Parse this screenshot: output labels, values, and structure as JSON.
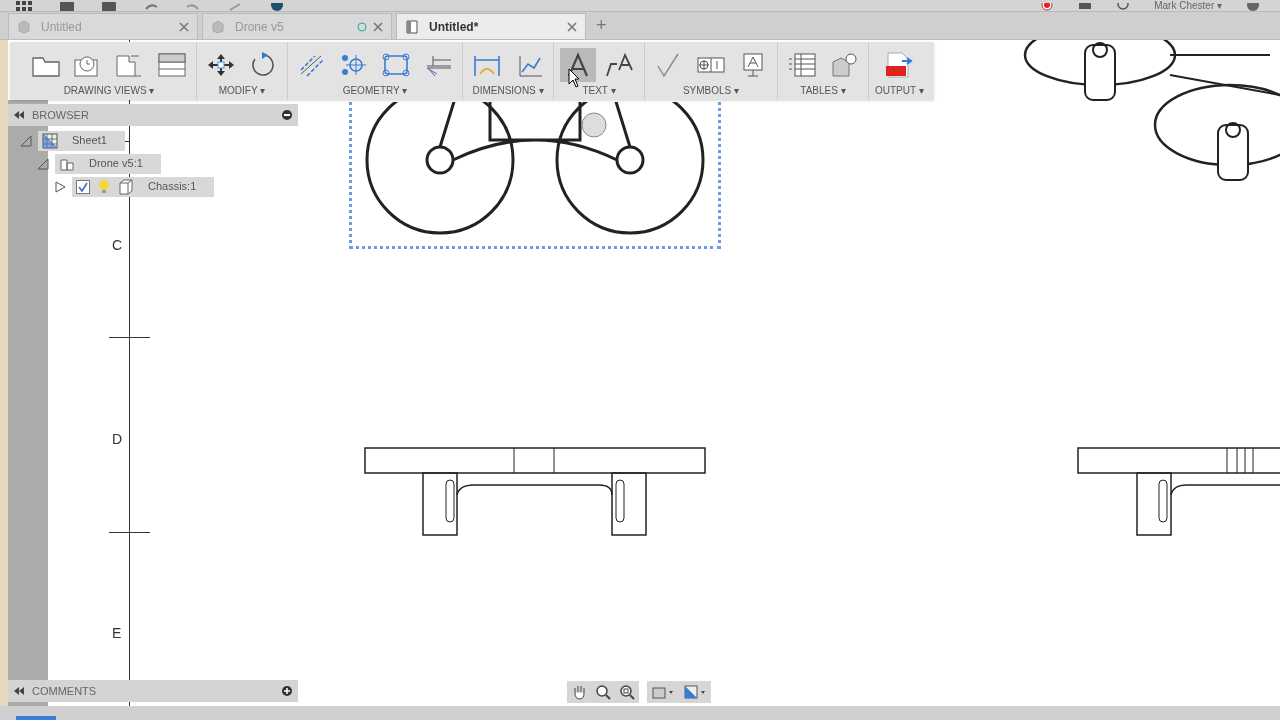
{
  "app_bar": {
    "user": "Mark Chester ▾"
  },
  "tabs": [
    {
      "label": "Untitled",
      "selected": false,
      "kind": "model"
    },
    {
      "label": "Drone v5",
      "selected": false,
      "kind": "model"
    },
    {
      "label": "Untitled*",
      "selected": true,
      "kind": "drawing"
    }
  ],
  "new_tab": "+",
  "toolbar": [
    {
      "label": "DRAWING VIEWS ▾",
      "tools": [
        {
          "selected": false
        },
        {
          "selected": false
        },
        {
          "selected": false
        },
        {
          "selected": false
        }
      ]
    },
    {
      "label": "MODIFY ▾",
      "tools": [
        {
          "selected": false
        },
        {
          "selected": false
        }
      ]
    },
    {
      "label": "GEOMETRY ▾",
      "tools": [
        {
          "selected": false
        },
        {
          "selected": false
        },
        {
          "selected": false
        },
        {
          "selected": false
        }
      ]
    },
    {
      "label": "DIMENSIONS ▾",
      "tools": [
        {
          "selected": false
        },
        {
          "selected": false
        }
      ]
    },
    {
      "label": "TEXT ▾",
      "tools": [
        {
          "selected": true
        },
        {
          "selected": false
        }
      ]
    },
    {
      "label": "SYMBOLS ▾",
      "tools": [
        {
          "selected": false
        },
        {
          "selected": false
        },
        {
          "selected": false
        }
      ]
    },
    {
      "label": "TABLES ▾",
      "tools": [
        {
          "selected": false
        },
        {
          "selected": false
        }
      ]
    },
    {
      "label": "OUTPUT ▾",
      "tools": [
        {
          "selected": false
        }
      ]
    }
  ],
  "browser": {
    "title": "BROWSER",
    "items": [
      {
        "label": "Sheet1",
        "kind": "sheet",
        "expanded": true,
        "children": [
          {
            "label": "Drone v5:1",
            "kind": "assembly",
            "expanded": true,
            "children": [
              {
                "label": "Chassis:1",
                "kind": "component",
                "expanded": false,
                "checked": true
              }
            ]
          }
        ]
      }
    ]
  },
  "sheet_zones": [
    "C",
    "D",
    "E"
  ],
  "comments": {
    "title": "COMMENTS"
  }
}
